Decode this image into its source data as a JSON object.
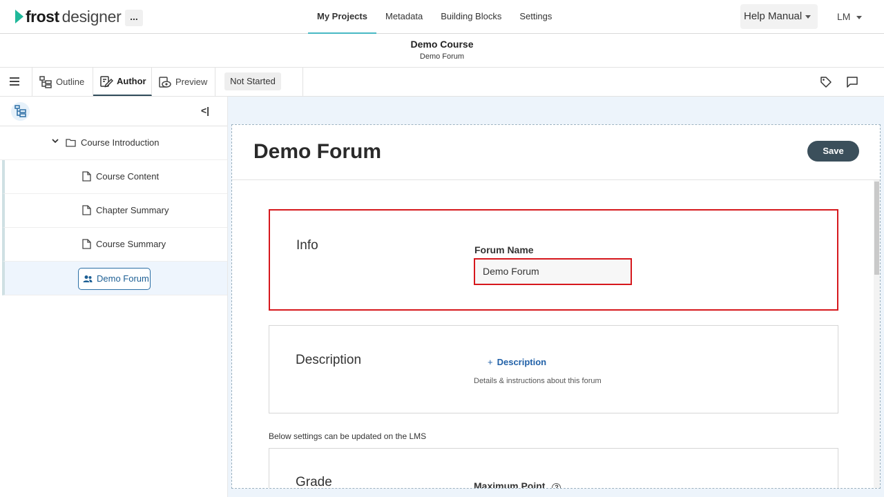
{
  "app": {
    "logo_bold": "frost",
    "logo_light": "designer",
    "more_label": "..."
  },
  "nav": {
    "items": [
      {
        "label": "My Projects",
        "active": true
      },
      {
        "label": "Metadata",
        "active": false
      },
      {
        "label": "Building Blocks",
        "active": false
      },
      {
        "label": "Settings",
        "active": false
      }
    ],
    "help_label": "Help Manual",
    "user_initials": "LM"
  },
  "header": {
    "course_title": "Demo Course",
    "course_subtitle": "Demo Forum"
  },
  "toolbar": {
    "tabs": [
      {
        "label": "Outline",
        "icon": "outline-icon"
      },
      {
        "label": "Author",
        "icon": "author-icon",
        "active": true
      },
      {
        "label": "Preview",
        "icon": "preview-icon"
      }
    ],
    "status": "Not Started"
  },
  "sidebar": {
    "collapse_label": "<|",
    "folder": "Course Introduction",
    "items": [
      {
        "label": "Course Content",
        "icon": "file-icon"
      },
      {
        "label": "Chapter Summary",
        "icon": "file-icon"
      },
      {
        "label": "Course Summary",
        "icon": "file-icon"
      },
      {
        "label": "Demo Forum",
        "icon": "forum-icon",
        "selected": true
      }
    ]
  },
  "main": {
    "title": "Demo Forum",
    "save_label": "Save",
    "info": {
      "section_title": "Info",
      "field_label": "Forum Name",
      "field_value": "Demo Forum"
    },
    "description": {
      "section_title": "Description",
      "add_label": "Description",
      "plus": "+",
      "help_text": "Details & instructions about this forum"
    },
    "lms_note": "Below settings can be updated on the LMS",
    "grade": {
      "section_title": "Grade",
      "field_label": "Maximum Point",
      "help_glyph": "?"
    }
  },
  "colors": {
    "accent": "#47b8c4",
    "highlight": "#d6171c",
    "save_button": "#3b4f5b",
    "link": "#2161a8"
  }
}
